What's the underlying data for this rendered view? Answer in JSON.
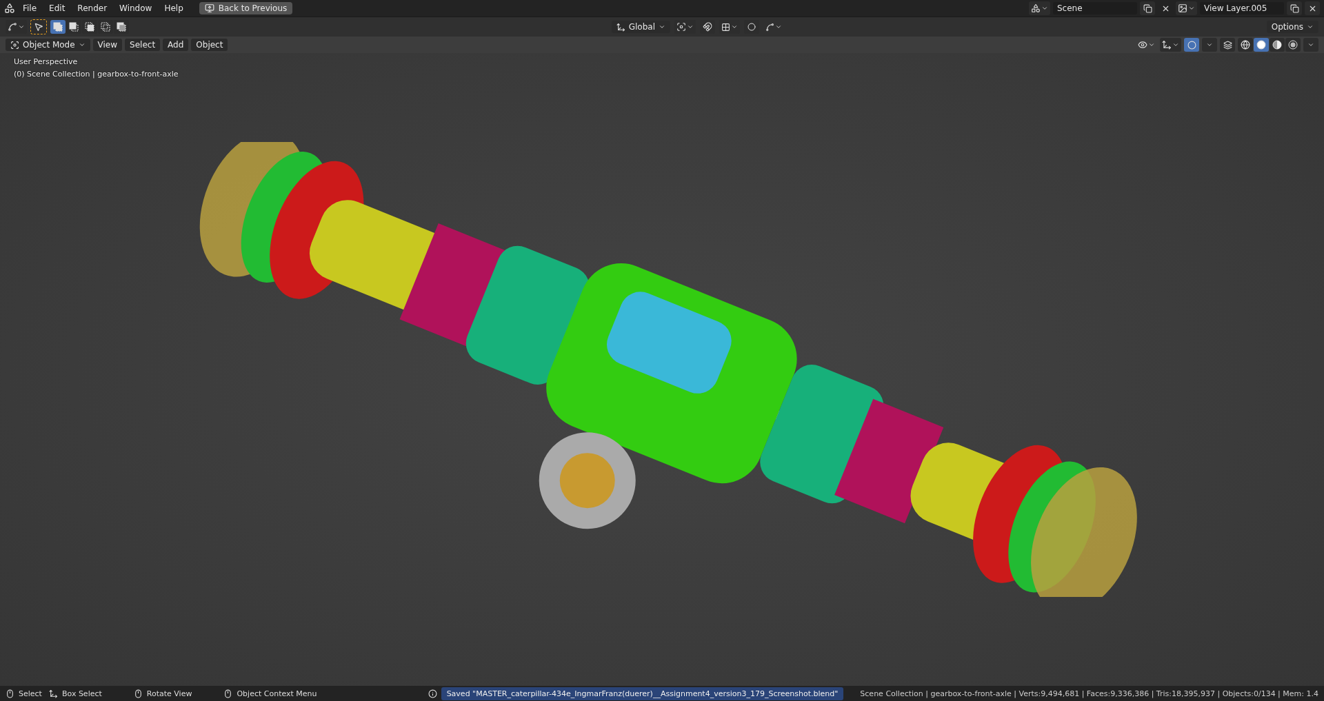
{
  "topbar": {
    "menus": [
      "File",
      "Edit",
      "Render",
      "Window",
      "Help"
    ],
    "back_button": "Back to Previous",
    "scene": "Scene",
    "view_layer": "View Layer.005"
  },
  "tool_header": {
    "select_modes": [
      {
        "kind": "set",
        "selected": true
      },
      {
        "kind": "extend",
        "selected": false
      },
      {
        "kind": "subtract",
        "selected": false
      },
      {
        "kind": "invert",
        "selected": false
      },
      {
        "kind": "intersect",
        "selected": false
      }
    ],
    "orientation": "Global",
    "snap_on": false,
    "proportional_on": false,
    "options": "Options"
  },
  "viewport_header": {
    "mode": "Object Mode",
    "menus": [
      "View",
      "Select",
      "Add",
      "Object"
    ],
    "overlays_on": true,
    "xray_on": false,
    "shading": [
      {
        "kind": "wireframe",
        "selected": false
      },
      {
        "kind": "solid",
        "selected": true
      },
      {
        "kind": "material",
        "selected": false
      },
      {
        "kind": "rendered",
        "selected": false
      }
    ]
  },
  "viewport": {
    "view_name": "User Perspective",
    "collection_line": "(0) Scene Collection | gearbox-to-front-axle"
  },
  "status_bar": {
    "hints": [
      {
        "kind": "left",
        "label": "Select"
      },
      {
        "kind": "drag",
        "label": "Box Select"
      },
      {
        "kind": "middle",
        "label": "Rotate View"
      },
      {
        "kind": "right",
        "label": "Object Context Menu"
      }
    ],
    "report": "Saved \"MASTER_caterpillar-434e_IngmarFranz(duerer)__Assignment4_version3_179_Screenshot.blend\"",
    "stats": "Scene Collection | gearbox-to-front-axle | Verts:9,494,681 | Faces:9,336,386 | Tris:18,395,937 | Objects:0/134 | Mem: 1.4"
  }
}
